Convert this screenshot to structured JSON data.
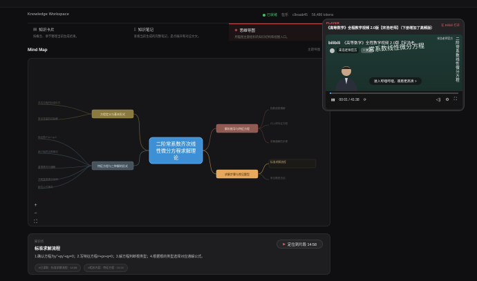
{
  "header": {
    "workspace_title": "Knowledge Workspace",
    "status_ok": "已就绪",
    "status_model": "在乐",
    "status_id": "c9eaab45",
    "status_tokens": "56,486 tokens"
  },
  "tabs": [
    {
      "icon": "▤",
      "label": "知识卡片",
      "sub": "按概念、章节整理当前生成结果。",
      "active": false
    },
    {
      "icon": "▯",
      "label": "知识笔记",
      "sub": "查看当前生成的完整笔记，是点展开和对应文文。",
      "active": false
    },
    {
      "icon": "◈",
      "label": "思维导图",
      "sub": "用脑图主题组织的知识结构和视图入口。",
      "active": true
    }
  ],
  "mindmap": {
    "title": "Mind Map",
    "side_hint": "主题导图",
    "center": [
      "二阶常系数齐次线",
      "性微分方程求解理",
      "论"
    ],
    "left_nodes": [
      "方程定义与基本形式",
      "特征方程与三种解的形式"
    ],
    "right_nodes": [
      "解析推导与特征方程",
      "求解步骤与常见题型"
    ],
    "left_leaves": [
      "齐次方程的标准形式",
      "常见变量的初始解",
      "特征根r²+pr+q=0",
      "两个相异实根情况",
      "重根情况与通解",
      "共轭复根情况说明",
      "欧拉公式推导"
    ],
    "right_leaves": [
      "指数函数猜解",
      "代入得特征方程",
      "求解通解的步骤",
      "标准求解流程",
      "常见题型总结"
    ],
    "zoom": {
      "in": "+",
      "out": "−",
      "fit": "⛶"
    }
  },
  "info": {
    "tag": "知识点",
    "heading": "标准求解流程",
    "body": "1.确认方程为y''+py'+qy=0；2.写特征方程r²+pr+q=0；3.解方程判断根类型；4.根据根的类型选择对应通解公式。",
    "chips": [
      "#已读取 · 标准求解流程 · 14:58",
      "#相关内容 · 特征方程 · 10:24"
    ],
    "jump_label": "定位到片段 14:58"
  },
  "player": {
    "label": "PLAYER",
    "title": "《高等数学》全程教学视频 2.0版【宋浩老师】（下册增加了高频版）",
    "open": "在 Bilibili 打开",
    "video_title": "《高等数学》全程教学视频 2.0版【宋浩老...",
    "logo": "bilibili",
    "channel": "宋浩老师官方",
    "follow": "+ 关注",
    "corner": "宋浩老师官方",
    "vertical": "二阶常系数线性微分方程",
    "chalk": "常系数线性微分方程",
    "banner": "进入哔哩哔哩，观看更高清 >",
    "time": "00:01 / 41:38",
    "progress": 0.0004
  }
}
